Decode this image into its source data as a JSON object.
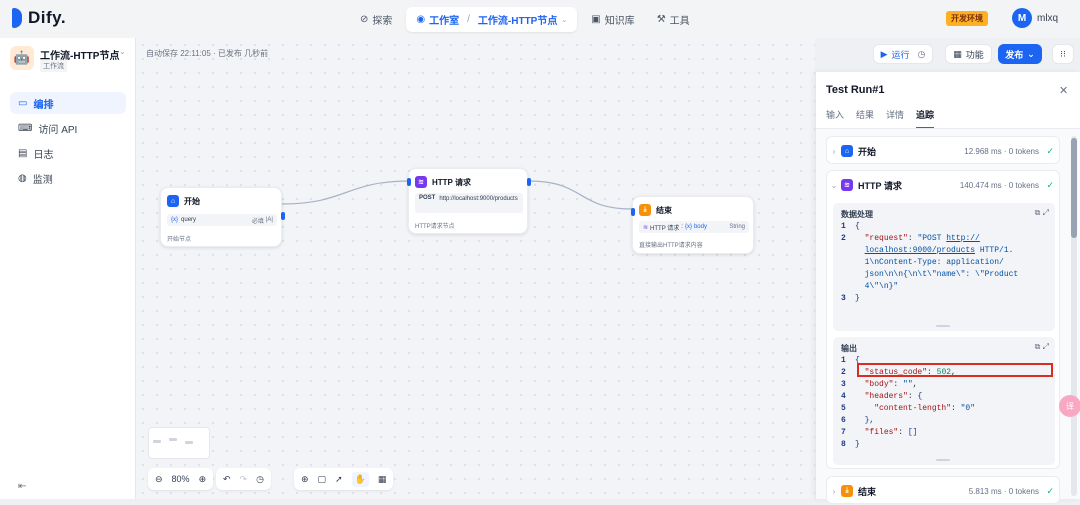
{
  "brand": {
    "name": "Dify."
  },
  "nav": {
    "explore": "探索",
    "studio": "工作室",
    "current_app": "工作流-HTTP节点",
    "knowledge": "知识库",
    "tools": "工具"
  },
  "env_badge": "开发环境",
  "user": {
    "initial": "M",
    "name": "mlxq"
  },
  "app": {
    "name": "工作流-HTTP节点",
    "type": "工作流"
  },
  "sidebar": {
    "items": [
      {
        "label": "编排",
        "icon": "layout-icon"
      },
      {
        "label": "访问 API",
        "icon": "terminal-icon"
      },
      {
        "label": "日志",
        "icon": "log-icon"
      },
      {
        "label": "监测",
        "icon": "monitor-icon"
      }
    ]
  },
  "canvas": {
    "autosave": "自动保存 22:11:05 · 已发布 几秒前"
  },
  "toolbar": {
    "run": "运行",
    "features": "功能",
    "publish": "发布",
    "zoom": "80%"
  },
  "nodes": {
    "start": {
      "title": "开始",
      "var_name": "query",
      "var_required": "必填",
      "desc": "开始节点"
    },
    "http": {
      "title": "HTTP 请求",
      "method": "POST",
      "url": "http://localhost:9000/products",
      "desc": "HTTP请求节点"
    },
    "end": {
      "title": "结束",
      "var_source": "HTTP 请求",
      "var_name": "body",
      "var_type": "String",
      "desc": "直接输出HTTP请求内容"
    }
  },
  "panel": {
    "title": "Test Run#1",
    "tabs": [
      "输入",
      "结果",
      "详情",
      "追踪"
    ],
    "traces": [
      {
        "name": "开始",
        "meta": "12.968 ms · 0 tokens"
      },
      {
        "name": "HTTP 请求",
        "meta": "140.474 ms · 0 tokens"
      },
      {
        "name": "结束",
        "meta": "5.813 ms · 0 tokens"
      }
    ],
    "data_processing": {
      "title": "数据处理",
      "request_key": "\"request\"",
      "request_part1": "\"POST ",
      "request_url1": "http://",
      "request_url2": "localhost:9000/products",
      "request_part2": " HTTP/1.",
      "request_part3": "1\\nContent-Type: application/",
      "request_part4": "json\\n\\n{\\n\\t\\\"name\\\": \\\"Product ",
      "request_part5": "4\\\"\\n}\""
    },
    "output": {
      "title": "输出",
      "status_key": "\"status_code\"",
      "status_val": "502",
      "body_key": "\"body\"",
      "body_val": "\"\"",
      "headers_key": "\"headers\"",
      "cl_key": "\"content-length\"",
      "cl_val": "\"0\"",
      "files_key": "\"files\""
    }
  },
  "float_button": "译"
}
